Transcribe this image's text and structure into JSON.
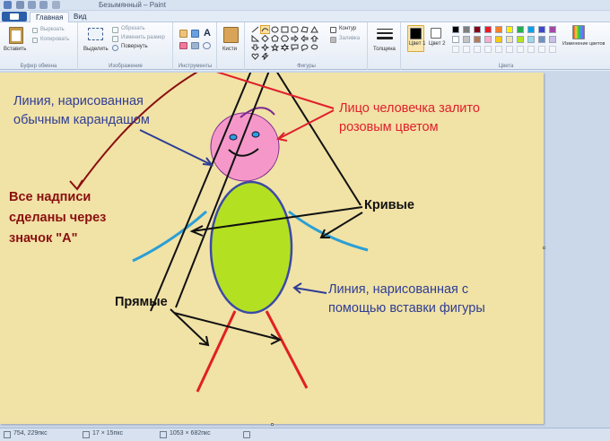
{
  "window": {
    "title": "Безымянный – Paint"
  },
  "menu": {
    "home_tab": "Главная",
    "view_tab": "Вид"
  },
  "ribbon": {
    "clipboard": {
      "paste": "Вставить",
      "cut": "Вырезать",
      "copy": "Копировать",
      "group": "Буфер обмена"
    },
    "image": {
      "select": "Выделить",
      "crop": "Обрезать",
      "resize": "Изменить размер",
      "rotate": "Повернуть",
      "group": "Изображение"
    },
    "tools": {
      "group": "Инструменты",
      "text_tool": "A"
    },
    "brushes": {
      "label": "Кисти"
    },
    "shapes": {
      "outline": "Контур",
      "fill": "Заливка",
      "group": "Фигуры"
    },
    "size": {
      "label": "Толщина"
    },
    "colors": {
      "color1": "Цвет 1",
      "color2": "Цвет 2",
      "edit": "Изменение цветов",
      "group": "Цвета",
      "palette_row1": [
        "#000000",
        "#7f7f7f",
        "#880015",
        "#ed1c24",
        "#ff7f27",
        "#fff200",
        "#22b14c",
        "#00a2e8",
        "#3f48cc",
        "#a349a4"
      ],
      "palette_row2": [
        "#ffffff",
        "#c3c3c3",
        "#b97a57",
        "#ffaec9",
        "#ffc90e",
        "#efe4b0",
        "#b5e61d",
        "#99d9ea",
        "#7092be",
        "#c8bfe7"
      ],
      "current1": "#000000",
      "current2": "#ffffff"
    }
  },
  "canvas": {
    "background": "#f1e2a6",
    "annotations": {
      "pencil_line": [
        "Линия, нарисованная",
        "обычным карандашом"
      ],
      "face_fill": [
        "Лицо человечка залито",
        "розовым цветом"
      ],
      "text_note": [
        "Все надписи",
        "сделаны через",
        "значок \"А\""
      ],
      "curves": "Кривые",
      "straight": "Прямые",
      "shape_line": [
        "Линия, нарисованная с",
        "помощью вставки фигуры"
      ]
    },
    "colors": {
      "face": "#f598c9",
      "body": "#b4e022",
      "arms": "#2a9fd6",
      "legs": "#e02020"
    }
  },
  "status": {
    "cursor": "754, 229пкс",
    "selection": "17 × 15пкс",
    "image_size": "1053 × 682пкс"
  }
}
